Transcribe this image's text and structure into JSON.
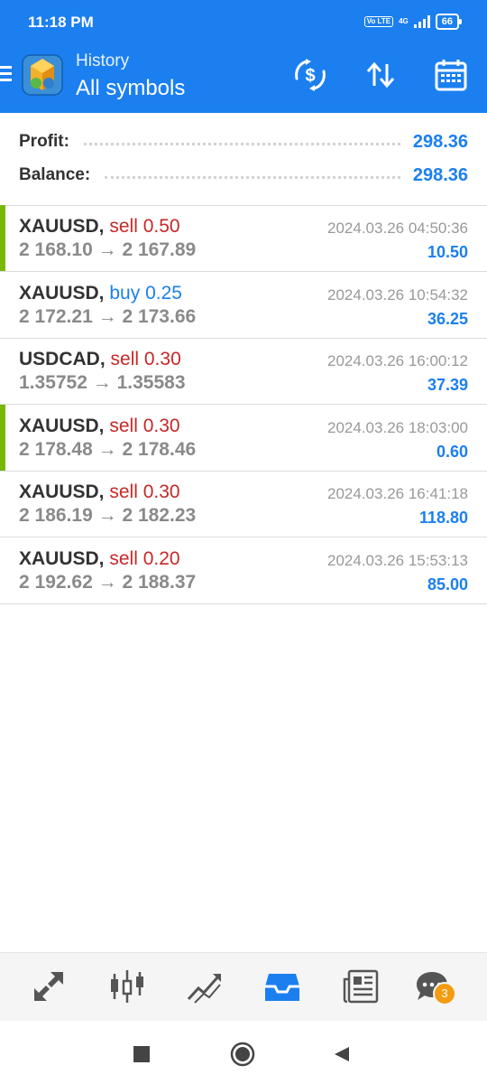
{
  "status_bar": {
    "time": "11:18 PM",
    "volte": "Vo LTE",
    "network": "4G",
    "battery": "66"
  },
  "header": {
    "subtitle": "History",
    "title": "All symbols"
  },
  "summary": {
    "profit_label": "Profit:",
    "profit_value": "298.36",
    "balance_label": "Balance:",
    "balance_value": "298.36"
  },
  "trades": [
    {
      "symbol": "XAUUSD,",
      "side": "sell",
      "volume": "0.50",
      "open": "2 168.10",
      "close": "2 167.89",
      "time": "2024.03.26 04:50:36",
      "profit": "10.50"
    },
    {
      "symbol": "XAUUSD,",
      "side": "buy",
      "volume": "0.25",
      "open": "2 172.21",
      "close": "2 173.66",
      "time": "2024.03.26 10:54:32",
      "profit": "36.25"
    },
    {
      "symbol": "USDCAD,",
      "side": "sell",
      "volume": "0.30",
      "open": "1.35752",
      "close": "1.35583",
      "time": "2024.03.26 16:00:12",
      "profit": "37.39"
    },
    {
      "symbol": "XAUUSD,",
      "side": "sell",
      "volume": "0.30",
      "open": "2 178.48",
      "close": "2 178.46",
      "time": "2024.03.26 18:03:00",
      "profit": "0.60"
    },
    {
      "symbol": "XAUUSD,",
      "side": "sell",
      "volume": "0.30",
      "open": "2 186.19",
      "close": "2 182.23",
      "time": "2024.03.26 16:41:18",
      "profit": "118.80"
    },
    {
      "symbol": "XAUUSD,",
      "side": "sell",
      "volume": "0.20",
      "open": "2 192.62",
      "close": "2 188.37",
      "time": "2024.03.26 15:53:13",
      "profit": "85.00"
    }
  ],
  "arrow": "→",
  "bottom_nav": {
    "chat_badge": "3",
    "active": "history"
  },
  "colors": {
    "accent": "#1b7ff0",
    "sell": "#c62828",
    "marker": "#7ab800",
    "badge": "#f39c12"
  }
}
